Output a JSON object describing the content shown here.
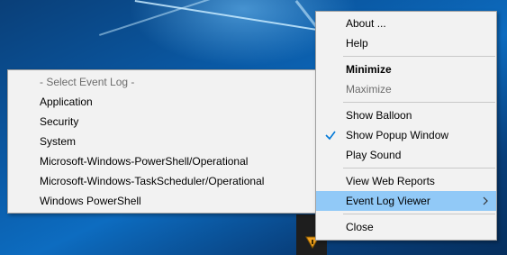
{
  "main_menu": {
    "about": "About ...",
    "help": "Help",
    "minimize": "Minimize",
    "maximize": "Maximize",
    "show_balloon": "Show Balloon",
    "show_popup_window": "Show Popup Window",
    "show_popup_window_checked": true,
    "play_sound": "Play Sound",
    "view_web_reports": "View Web Reports",
    "event_log_viewer": "Event Log Viewer",
    "close": "Close"
  },
  "sub_menu": {
    "placeholder": "- Select Event Log -",
    "items": [
      "Application",
      "Security",
      "System",
      "Microsoft-Windows-PowerShell/Operational",
      "Microsoft-Windows-TaskScheduler/Operational",
      "Windows PowerShell"
    ]
  },
  "colors": {
    "menu_bg": "#f2f2f2",
    "highlight": "#91c9f7",
    "check_blue": "#0078d7",
    "disabled_text": "#6d6d6d"
  },
  "icons": {
    "check": "checkmark-icon",
    "submenu_arrow": "chevron-right-icon",
    "tray": "app-tray-icon"
  }
}
